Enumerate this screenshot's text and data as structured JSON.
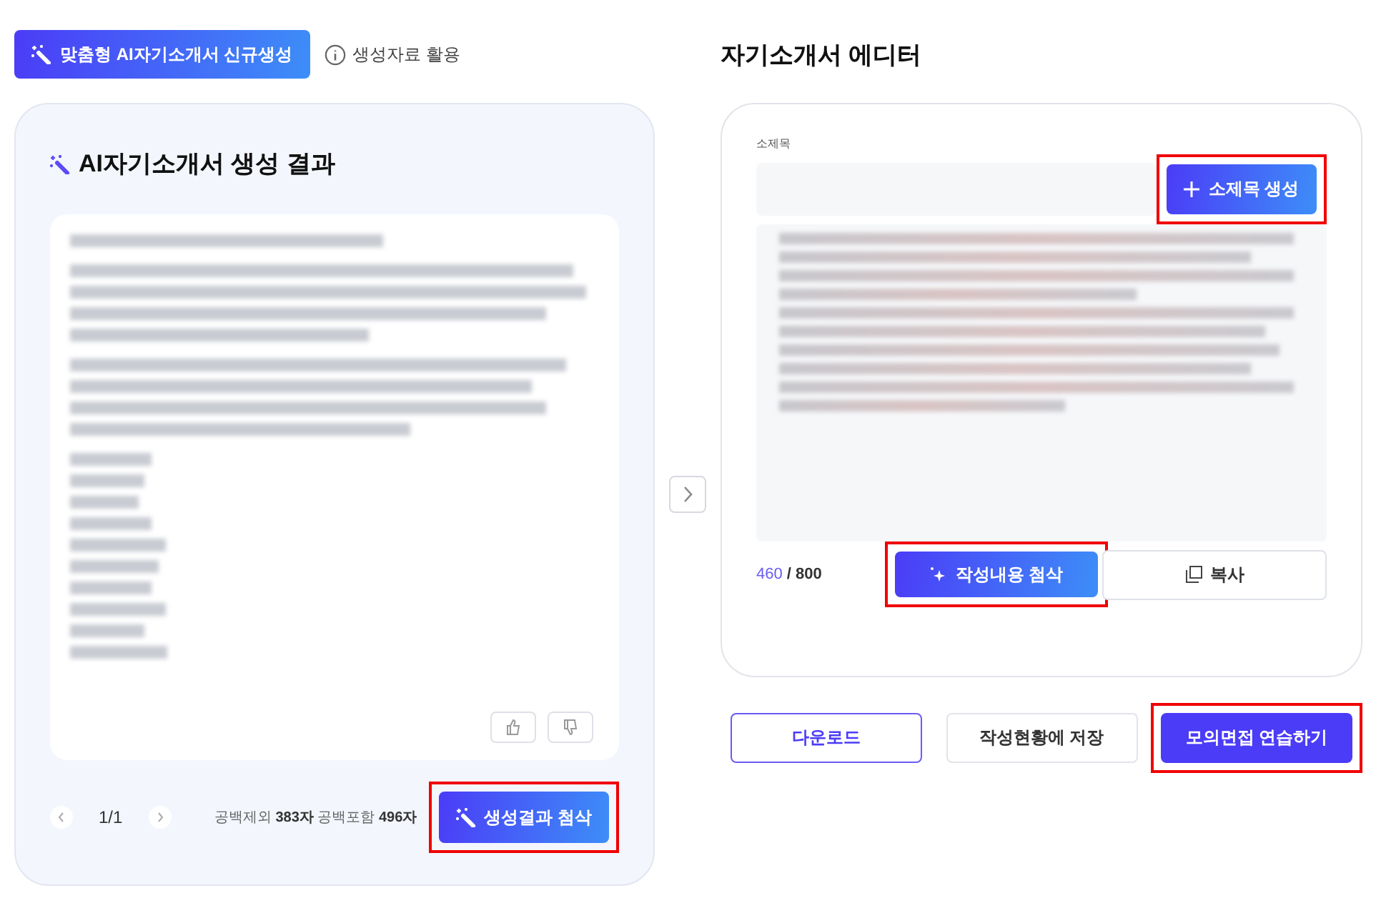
{
  "top_bar": {
    "generate_button": {
      "label": "맞춤형 AI자기소개서 신규생성"
    },
    "info_link": {
      "label": "생성자료 활용"
    }
  },
  "result_panel": {
    "title": "AI자기소개서 생성 결과",
    "feedback": [
      {
        "kind": "like"
      },
      {
        "kind": "dislike"
      }
    ],
    "pager": {
      "label": "1/1"
    },
    "counts": [
      {
        "label": "공백제외",
        "value": "383자"
      },
      {
        "label": "공백포함",
        "value": "496자"
      }
    ],
    "apply_button": {
      "label": "생성결과 첨삭",
      "highlighted": true
    }
  },
  "editor": {
    "title": "자기소개서 에디터",
    "subtitle_label": "소제목",
    "subtitle_button": {
      "label": "소제목 생성",
      "highlighted": true
    },
    "char_count": {
      "current": "460",
      "total": "/ 800"
    },
    "edit_button": {
      "label": "작성내용 첨삭",
      "highlighted": true
    },
    "copy_button": {
      "label": "복사"
    }
  },
  "actions": [
    {
      "label": "다운로드",
      "kind": "outline",
      "highlighted": false
    },
    {
      "label": "작성현황에 저장",
      "kind": "plain",
      "highlighted": false
    },
    {
      "label": "모의면접 연습하기",
      "kind": "primary",
      "highlighted": true
    }
  ]
}
